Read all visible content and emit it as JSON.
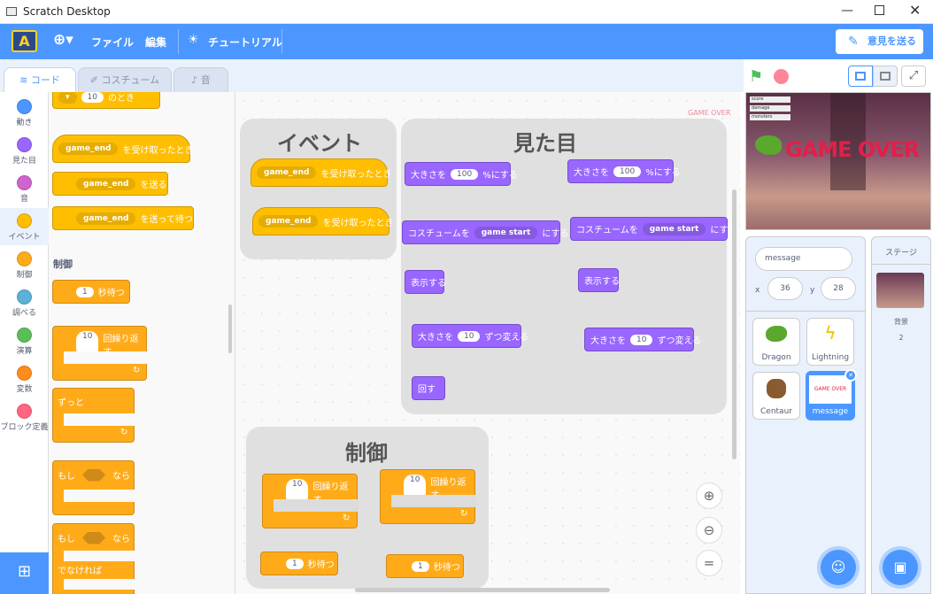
{
  "window": {
    "title": "Scratch Desktop"
  },
  "menu": {
    "file": "ファイル",
    "edit": "編集",
    "tutorials": "チュートリアル",
    "feedback": "意見を送る"
  },
  "tabs": {
    "code": "コード",
    "costumes": "コスチューム",
    "sounds": "音"
  },
  "categories": [
    "動き",
    "見た目",
    "音",
    "イベント",
    "制御",
    "調べる",
    "演算",
    "変数",
    "ブロック定義"
  ],
  "palette": {
    "when_loud": "のとき",
    "loud_val": "10",
    "receive_menu": "game_end",
    "receive_label": "を受け取ったとき",
    "broadcast_menu": "game_end",
    "broadcast_label": "を送る",
    "broadcast_wait_menu": "game_end",
    "broadcast_wait_label": "を送って待つ",
    "control_heading": "制御",
    "wait_val": "1",
    "wait_label": "秒待つ",
    "repeat_val": "10",
    "repeat_label": "回繰り返す",
    "forever_label": "ずっと",
    "if_label1": "もし",
    "if_label2": "なら",
    "ifelse_label1": "もし",
    "ifelse_label2": "なら",
    "else_label": "でなければ"
  },
  "workspace": {
    "event_title": "イベント",
    "looks_title": "見た目",
    "control_title": "制御",
    "game_over_label": "GAME OVER",
    "ev1_menu": "game_end",
    "ev1_label": "を受け取ったとき",
    "ev2_menu": "game_end",
    "ev2_label": "を受け取ったとき",
    "size1_a": "大きさを",
    "size1_val": "100",
    "size1_b": "%にする",
    "size2_a": "大きさを",
    "size2_val": "100",
    "size2_b": "%にする",
    "cos1_a": "コスチュームを",
    "cos1_menu": "game start",
    "cos1_b": "にする",
    "cos2_a": "コスチュームを",
    "cos2_menu": "game start",
    "cos2_b": "にする",
    "show1": "表示する",
    "show2": "表示する",
    "chg1_a": "大きさを",
    "chg1_val": "10",
    "chg1_b": "ずつ変える",
    "chg2_a": "大きさを",
    "chg2_val": "10",
    "chg2_b": "ずつ変える",
    "turn": "回す",
    "rep1_val": "10",
    "rep1_label": "回繰り返す",
    "rep2_val": "10",
    "rep2_label": "回繰り返す",
    "w1_val": "1",
    "w1_label": "秒待つ",
    "w2_val": "1",
    "w2_label": "秒待つ"
  },
  "stage": {
    "game_over_text": "GAME OVER",
    "monitors": [
      "score",
      "damage",
      "monsters"
    ]
  },
  "sprite_info": {
    "name": "message",
    "x_label": "x",
    "x": "36",
    "y_label": "y",
    "y": "28"
  },
  "sprites": [
    "Dragon",
    "Lightning",
    "Centaur",
    "message"
  ],
  "stage_pane": {
    "title": "ステージ",
    "backdrop_label": "背景",
    "backdrop_count": "2"
  },
  "colors": {
    "accent": "#4c97ff",
    "events": "#ffbf00",
    "control": "#ffab19",
    "looks": "#9966ff"
  }
}
